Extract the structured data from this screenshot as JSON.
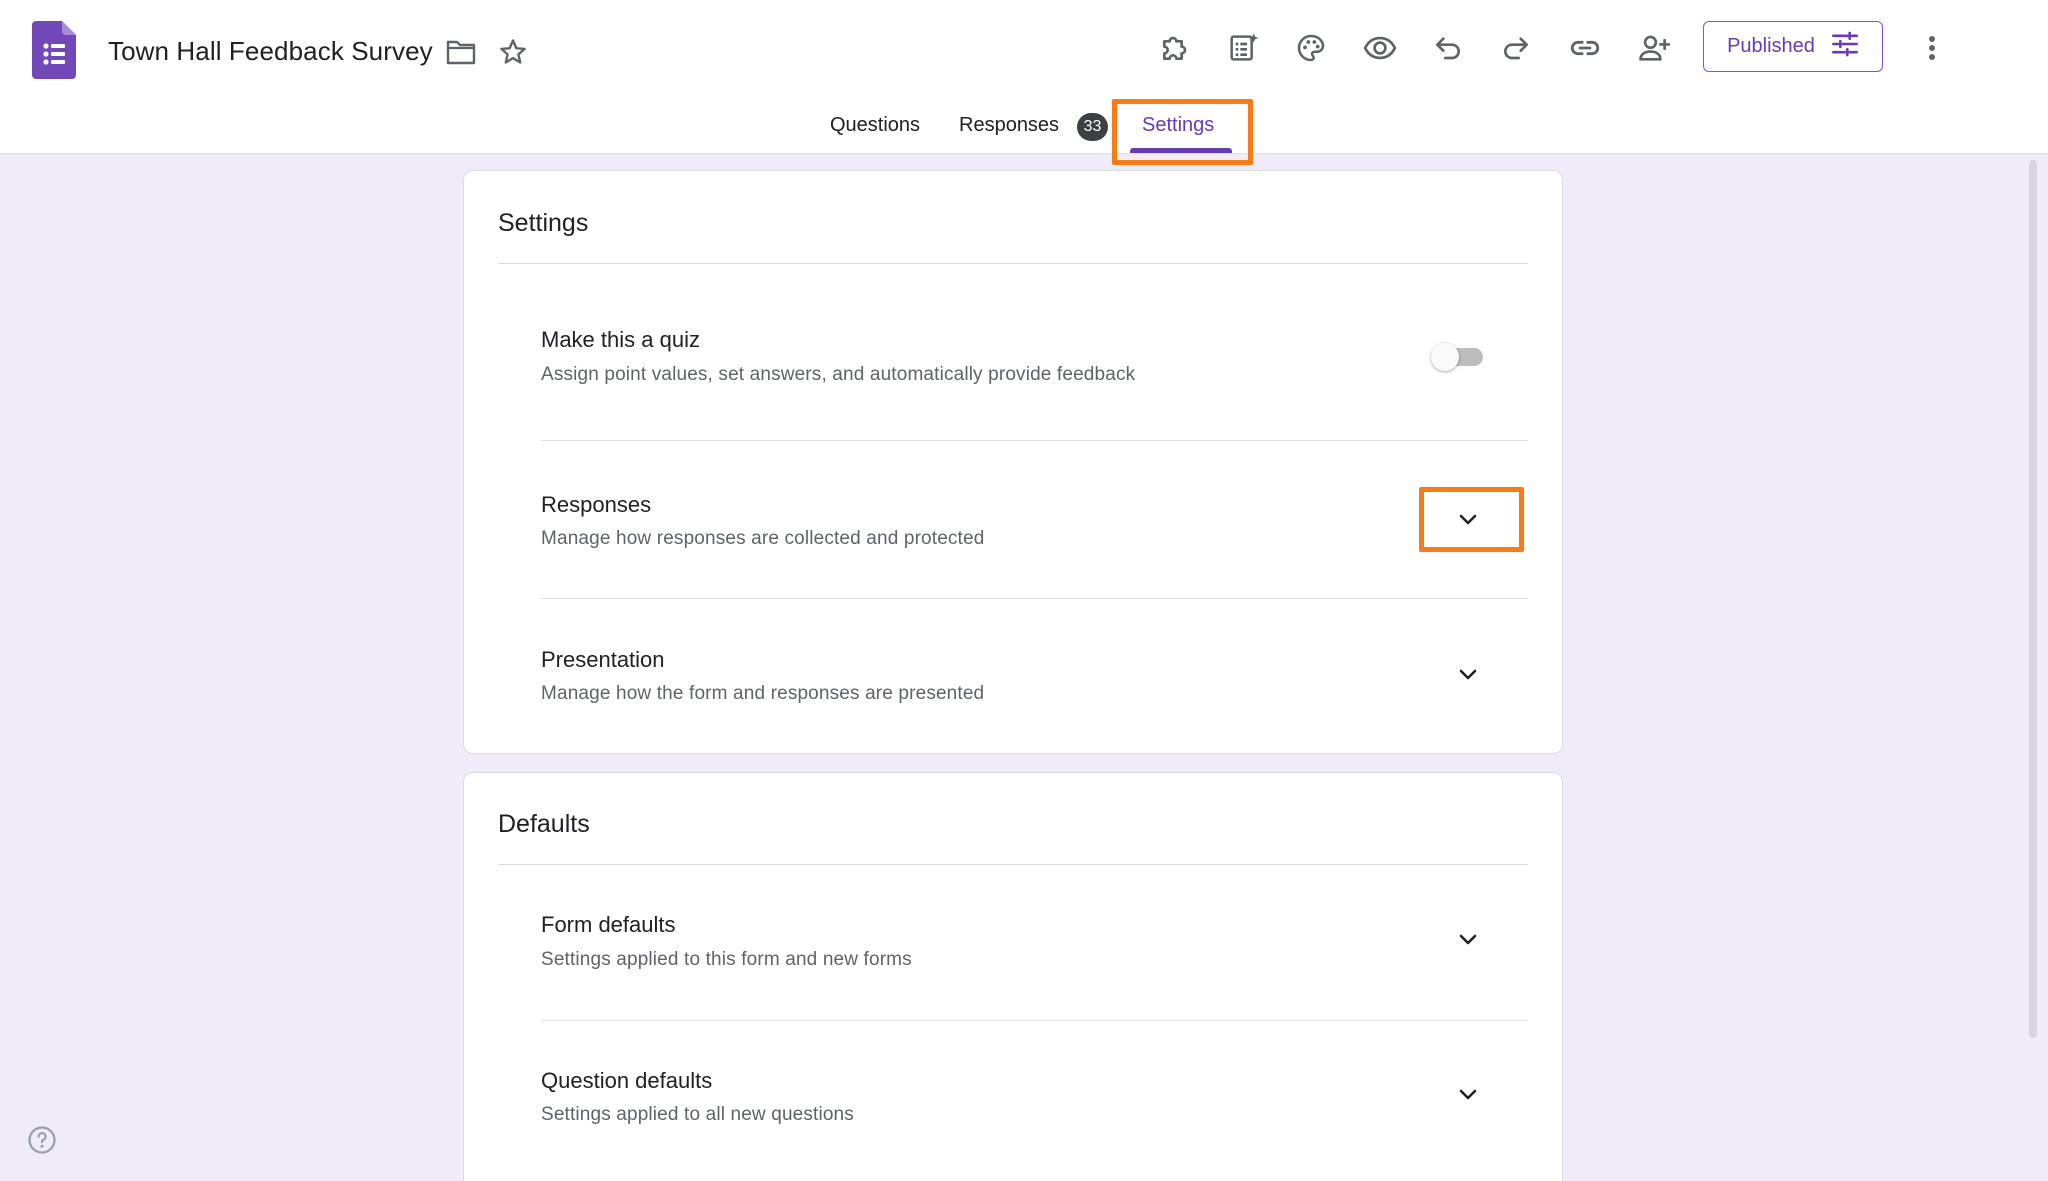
{
  "header": {
    "title": "Town Hall Feedback Survey",
    "app_icon": "google-forms-logo",
    "title_icons": [
      "folder-icon",
      "star-icon"
    ],
    "toolbar_icons": [
      "add-ons-icon",
      "gemini-form-icon",
      "palette-icon",
      "preview-eye-icon",
      "undo-icon",
      "redo-icon",
      "link-icon",
      "add-collaborator-icon"
    ],
    "publish_label": "Published",
    "publish_icon": "tune-sliders-icon",
    "more_icon": "more-vert-icon"
  },
  "tabs": {
    "items": [
      {
        "label": "Questions"
      },
      {
        "label": "Responses",
        "count": "33"
      },
      {
        "label": "Settings",
        "active": true
      }
    ]
  },
  "settings_card": {
    "title": "Settings",
    "rows": [
      {
        "title": "Make this a quiz",
        "desc": "Assign point values, set answers, and automatically provide feedback",
        "control": "toggle",
        "on": false
      },
      {
        "title": "Responses",
        "desc": "Manage how responses are collected and protected",
        "control": "expand"
      },
      {
        "title": "Presentation",
        "desc": "Manage how the form and responses are presented",
        "control": "expand"
      }
    ]
  },
  "defaults_card": {
    "title": "Defaults",
    "rows": [
      {
        "title": "Form defaults",
        "desc": "Settings applied to this form and new forms",
        "control": "expand"
      },
      {
        "title": "Question defaults",
        "desc": "Settings applied to all new questions",
        "control": "expand"
      }
    ]
  },
  "colors": {
    "brand": "#673ab7",
    "page_background": "#f0ebf8",
    "highlight": "#f77c17"
  },
  "help_icon": "help-circle-icon"
}
